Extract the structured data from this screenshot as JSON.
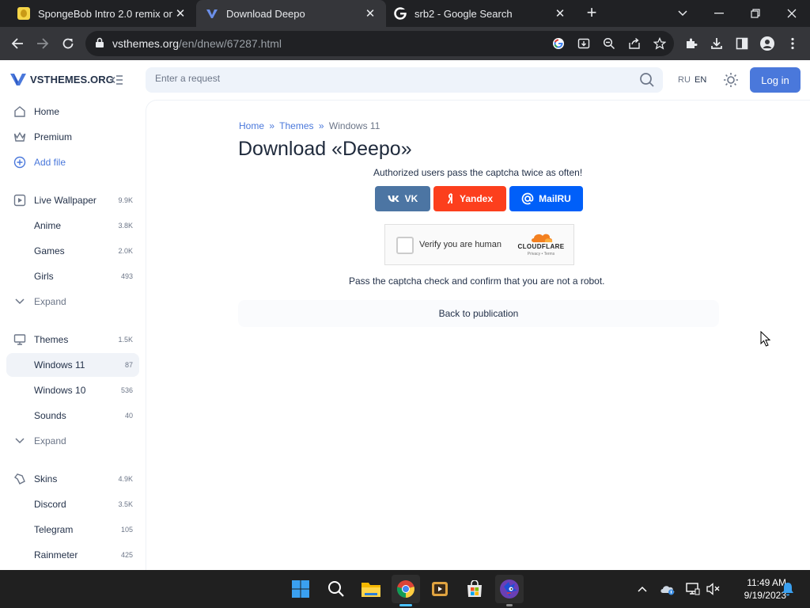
{
  "browser": {
    "tabs": [
      {
        "title": "SpongeBob Intro 2.0 remix on Sc"
      },
      {
        "title": "Download Deepo"
      },
      {
        "title": "srb2 - Google Search"
      }
    ],
    "new_tab_label": "+",
    "url_domain": "vsthemes.org",
    "url_path": "/en/dnew/67287.html"
  },
  "site": {
    "logo_text": "VSTHEMES.ORG",
    "search_placeholder": "Enter a request",
    "lang_ru": "RU",
    "lang_en": "EN",
    "login_label": "Log in"
  },
  "sidebar": {
    "items": [
      {
        "label": "Home",
        "count": ""
      },
      {
        "label": "Premium",
        "count": ""
      },
      {
        "label": "Add file",
        "count": ""
      },
      {
        "label": "Live Wallpaper",
        "count": "9.9K"
      },
      {
        "label": "Anime",
        "count": "3.8K"
      },
      {
        "label": "Games",
        "count": "2.0K"
      },
      {
        "label": "Girls",
        "count": "493"
      },
      {
        "label": "Expand",
        "count": ""
      },
      {
        "label": "Themes",
        "count": "1.5K"
      },
      {
        "label": "Windows 11",
        "count": "87"
      },
      {
        "label": "Windows 10",
        "count": "536"
      },
      {
        "label": "Sounds",
        "count": "40"
      },
      {
        "label": "Expand",
        "count": ""
      },
      {
        "label": "Skins",
        "count": "4.9K"
      },
      {
        "label": "Discord",
        "count": "3.5K"
      },
      {
        "label": "Telegram",
        "count": "105"
      },
      {
        "label": "Rainmeter",
        "count": "425"
      }
    ]
  },
  "main": {
    "breadcrumb": {
      "home": "Home",
      "sep1": "»",
      "themes": "Themes",
      "sep2": "»",
      "current": "Windows 11"
    },
    "title": "Download «Deepo»",
    "auth_note": "Authorized users pass the captcha twice as often!",
    "social": {
      "vk": "VK",
      "yandex": "Yandex",
      "mailru": "MailRU"
    },
    "captcha": {
      "label": "Verify you are human",
      "brand": "CLOUDFLARE",
      "sub": "Privacy • Terms"
    },
    "pass_note": "Pass the captcha check and confirm that you are not a robot.",
    "back_label": "Back to publication"
  },
  "taskbar": {
    "time": "11:49 AM",
    "date": "9/19/2023"
  },
  "colors": {
    "accent": "#4a78db",
    "vk": "#4c75a3",
    "yandex": "#fc3f1d",
    "mailru": "#005ff9",
    "cloudflare": "#f38020"
  }
}
